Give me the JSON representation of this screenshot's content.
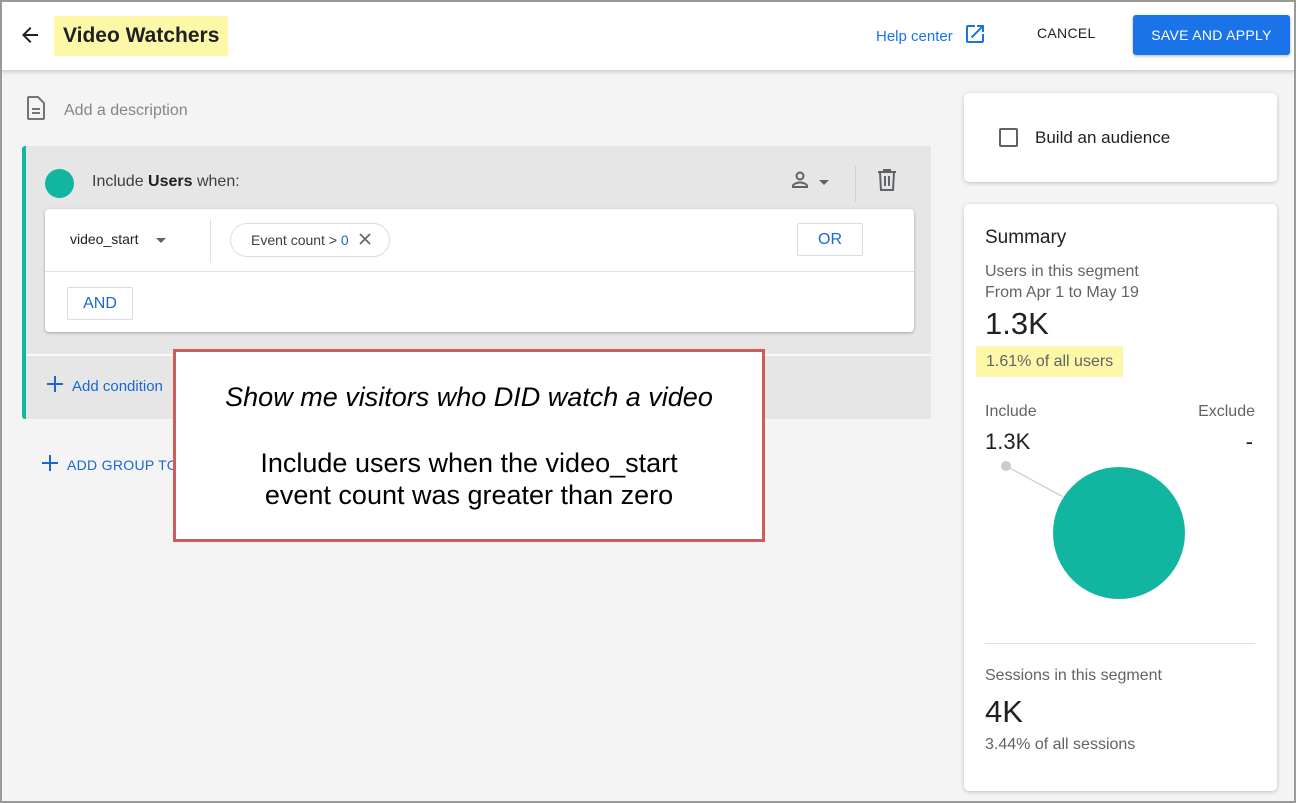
{
  "header": {
    "title": "Video Watchers",
    "help_label": "Help center",
    "cancel_label": "CANCEL",
    "save_label": "SAVE AND APPLY",
    "accent_color": "#1a73e8"
  },
  "description": {
    "placeholder": "Add a description"
  },
  "group": {
    "prefix": "Include ",
    "scope": "Users",
    "suffix": " when:",
    "color": "#12b5a0",
    "condition": {
      "event": "video_start",
      "chip_label": "Event count > ",
      "chip_value": "0"
    },
    "or_label": "OR",
    "and_label": "AND",
    "add_condition_label": "Add condition",
    "icons": {
      "scope": "person-icon",
      "delete": "trash-icon"
    }
  },
  "add_group_label": "ADD GROUP TO",
  "callout": {
    "line1": "Show me visitors who DID watch a video",
    "line2": "Include users when the video_start event count was greater than zero"
  },
  "audience": {
    "label": "Build an audience",
    "checked": false
  },
  "summary": {
    "title": "Summary",
    "users_label": "Users in this segment",
    "date_range": "From Apr 1 to May 19",
    "users_value": "1.3K",
    "users_pct": "1.61% of all users",
    "include_label": "Include",
    "exclude_label": "Exclude",
    "include_value": "1.3K",
    "exclude_value": "-",
    "sessions_label": "Sessions in this segment",
    "sessions_value": "4K",
    "sessions_pct": "3.44% of all sessions"
  },
  "chart_data": {
    "type": "pie",
    "title": "",
    "slices": [
      {
        "label": "Include",
        "value": 1300,
        "color": "#12b5a0"
      },
      {
        "label": "Exclude",
        "value": 0,
        "color": "#cccccc"
      }
    ]
  }
}
